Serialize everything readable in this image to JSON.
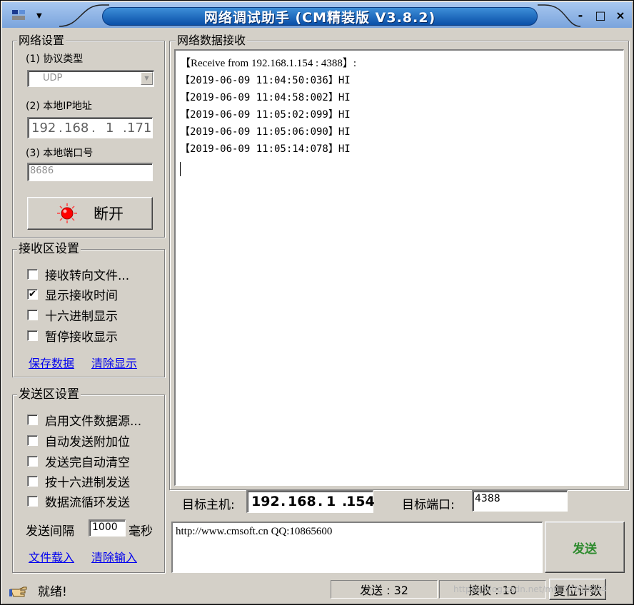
{
  "window": {
    "title": "网络调试助手 (CM精装版 V3.8.2)",
    "controls": {
      "minimize": "-",
      "maximize": "□",
      "close": "×"
    }
  },
  "network_settings": {
    "title": "网络设置",
    "protocol_label": "(1) 协议类型",
    "protocol_value": "UDP",
    "ip_label": "(2) 本地IP地址",
    "ip_octets": [
      "192",
      "168",
      "1",
      "171"
    ],
    "port_label": "(3) 本地端口号",
    "port_value": "8686",
    "disconnect_label": "断开"
  },
  "receive_settings": {
    "title": "接收区设置",
    "options": [
      {
        "label": "接收转向文件...",
        "checked": false
      },
      {
        "label": "显示接收时间",
        "checked": true
      },
      {
        "label": "十六进制显示",
        "checked": false
      },
      {
        "label": "暂停接收显示",
        "checked": false
      }
    ],
    "save_link": "保存数据",
    "clear_link": "清除显示"
  },
  "send_settings": {
    "title": "发送区设置",
    "options": [
      {
        "label": "启用文件数据源...",
        "checked": false
      },
      {
        "label": "自动发送附加位",
        "checked": false
      },
      {
        "label": "发送完自动清空",
        "checked": false
      },
      {
        "label": "按十六进制发送",
        "checked": false
      },
      {
        "label": "数据流循环发送",
        "checked": false
      }
    ],
    "interval_label": "发送间隔",
    "interval_value": "1000",
    "interval_unit": "毫秒",
    "load_file_link": "文件载入",
    "clear_input_link": "清除输入"
  },
  "receive_area": {
    "title": "网络数据接收",
    "lines": [
      "【Receive from 192.168.1.154 : 4388】:",
      "【2019-06-09 11:04:50:036】HI",
      "【2019-06-09 11:04:58:002】HI",
      "【2019-06-09 11:05:02:099】HI",
      "【2019-06-09 11:05:06:090】HI",
      "【2019-06-09 11:05:14:078】HI"
    ]
  },
  "target": {
    "host_label": "目标主机:",
    "host_octets": [
      "192",
      "168",
      "1",
      "154"
    ],
    "port_label": "目标端口:",
    "port_value": "4388"
  },
  "send_area": {
    "text": "http://www.cmsoft.cn QQ:10865600",
    "send_button": "发送"
  },
  "status_bar": {
    "status_text": "就绪!",
    "sent_label": "发送 : 32",
    "recv_label": "接收 : 10",
    "reset_button": "复位计数",
    "watermark": "https://blog.csdn.net/m0_37810244"
  },
  "colors": {
    "face": "#d4d0c8",
    "title_blue": "#0a4fa8",
    "link": "#0000ee",
    "send_button_text": "#2e8b2e",
    "led": "#ff0000"
  }
}
